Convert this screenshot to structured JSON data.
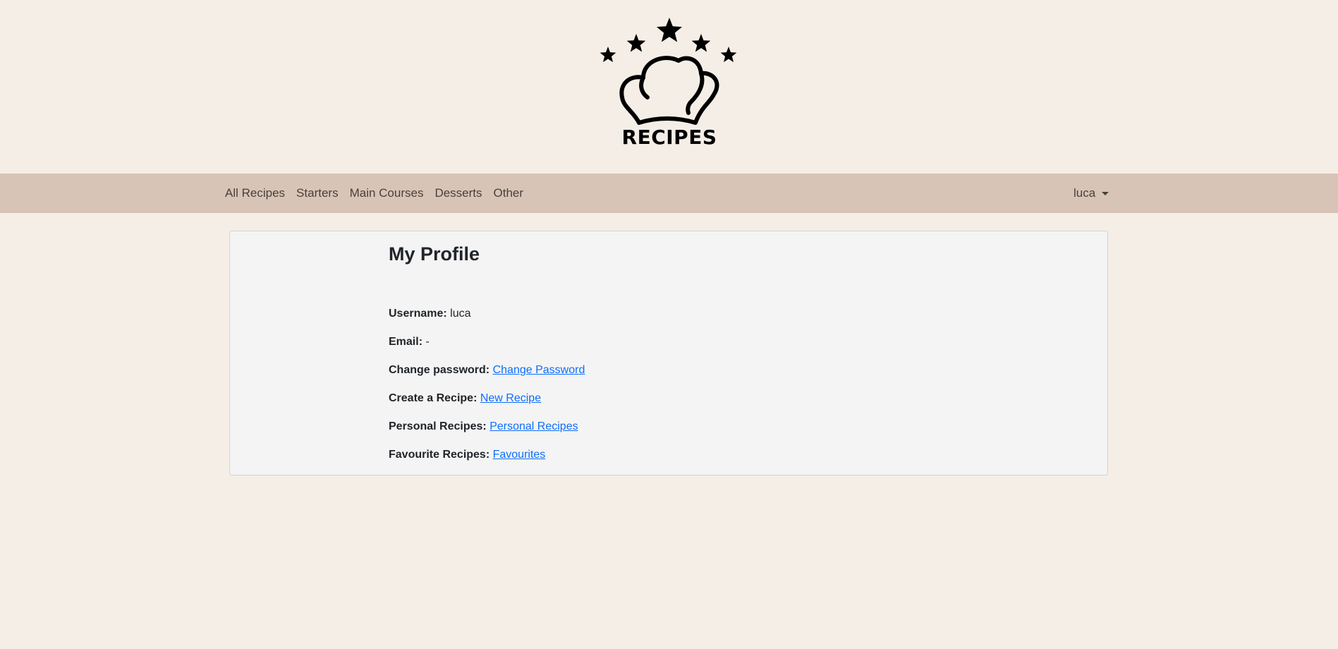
{
  "logo": {
    "text": "RECIPES",
    "icon": "chef-hat-with-stars-icon"
  },
  "nav": {
    "links": [
      "All Recipes",
      "Starters",
      "Main Courses",
      "Desserts",
      "Other"
    ],
    "user": "luca"
  },
  "profile": {
    "title": "My Profile",
    "username_label": "Username:",
    "username_value": "luca",
    "email_label": "Email:",
    "email_value": "-",
    "change_password_label": "Change password:",
    "change_password_link": "Change Password",
    "create_recipe_label": "Create a Recipe:",
    "create_recipe_link": "New Recipe",
    "personal_recipes_label": "Personal Recipes:",
    "personal_recipes_link": "Personal Recipes",
    "favourite_recipes_label": "Favourite Recipes:",
    "favourite_recipes_link": "Favourites"
  },
  "colors": {
    "background": "#f5eee7",
    "navbar": "#d8c4b6",
    "card": "#f4f4f4",
    "link": "#0d6efd"
  }
}
